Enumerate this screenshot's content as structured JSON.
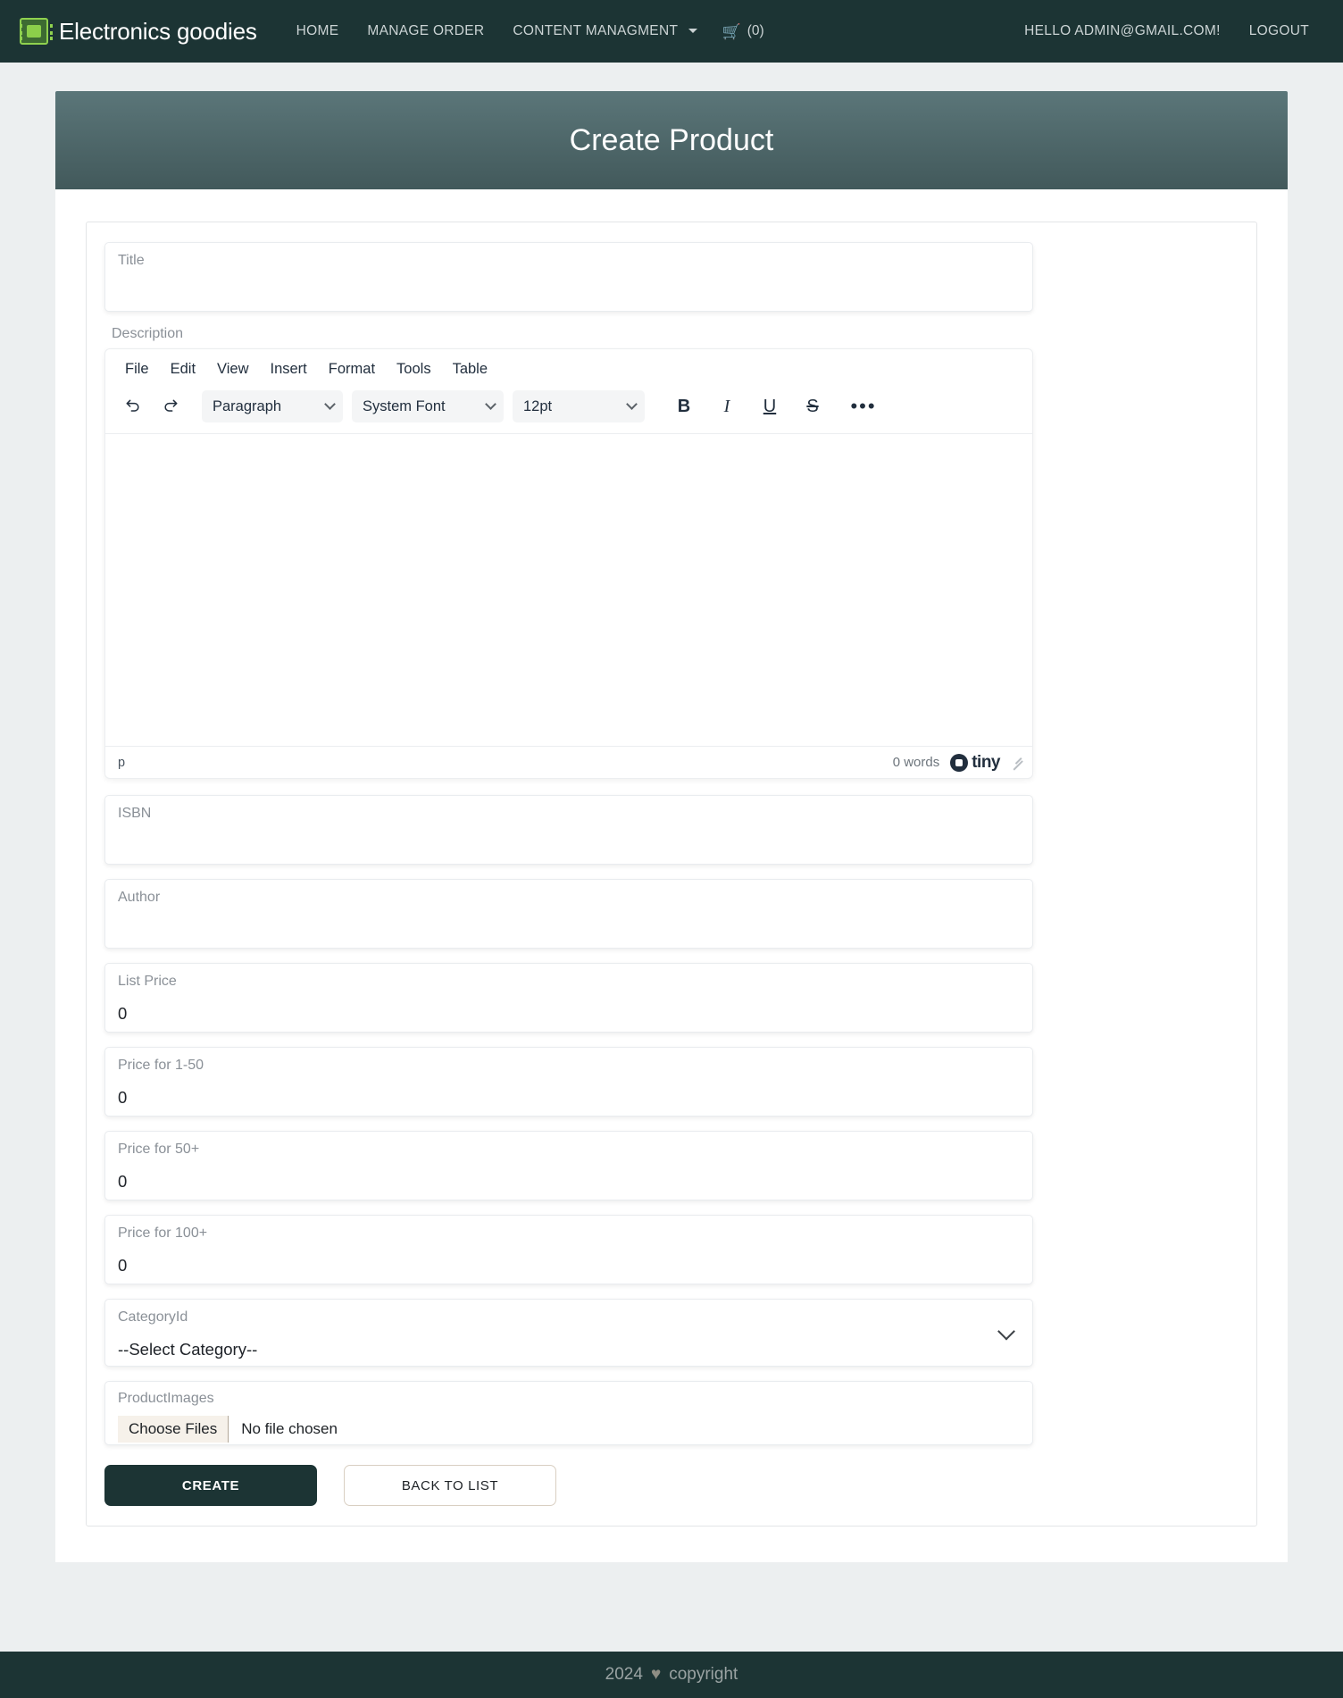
{
  "navbar": {
    "brand": "Electronics goodies",
    "brand_icon": "microchip-icon",
    "links": [
      {
        "label": "HOME",
        "name": "nav-link-home"
      },
      {
        "label": "MANAGE ORDER",
        "name": "nav-link-manage-order"
      },
      {
        "label": "CONTENT MANAGMENT",
        "name": "nav-link-content-managment",
        "has_caret": true
      }
    ],
    "cart": {
      "icon": "shopping-cart-icon",
      "count": "(0)"
    },
    "greeting": "HELLO ADMIN@GMAIL.COM!",
    "logout": "LOGOUT"
  },
  "header": {
    "title": "Create Product"
  },
  "form": {
    "title": {
      "label": "Title",
      "value": ""
    },
    "description": {
      "label": "Description"
    },
    "isbn": {
      "label": "ISBN",
      "value": ""
    },
    "author": {
      "label": "Author",
      "value": ""
    },
    "list_price": {
      "label": "List Price",
      "value": "0"
    },
    "price_1_50": {
      "label": "Price for 1-50",
      "value": "0"
    },
    "price_50": {
      "label": "Price for 50+",
      "value": "0"
    },
    "price_100": {
      "label": "Price for 100+",
      "value": "0"
    },
    "category": {
      "label": "CategoryId",
      "value": "--Select Category--"
    },
    "product_images": {
      "label": "ProductImages",
      "button": "Choose Files",
      "status": "No file chosen"
    },
    "buttons": {
      "create": "Create",
      "back": "Back to List"
    }
  },
  "editor": {
    "menubar": [
      "File",
      "Edit",
      "View",
      "Insert",
      "Format",
      "Tools",
      "Table"
    ],
    "toolbar": {
      "undo": "undo-icon",
      "redo": "redo-icon",
      "block_format": "Paragraph",
      "font_family": "System Font",
      "font_size": "12pt",
      "bold": "B",
      "italic": "I",
      "underline": "U",
      "strikethrough": "S",
      "more": "•••"
    },
    "status": {
      "path": "p",
      "words": "0 words",
      "brand": "tiny"
    }
  },
  "footer": {
    "year": "2024",
    "heart": "♥",
    "text": "copyright"
  },
  "colors": {
    "nav_bg": "#1c3434",
    "header_gradient_top": "#5b7679",
    "header_gradient_bottom": "#42595b",
    "page_bg": "#eceff0",
    "primary_button": "#1c3434"
  }
}
